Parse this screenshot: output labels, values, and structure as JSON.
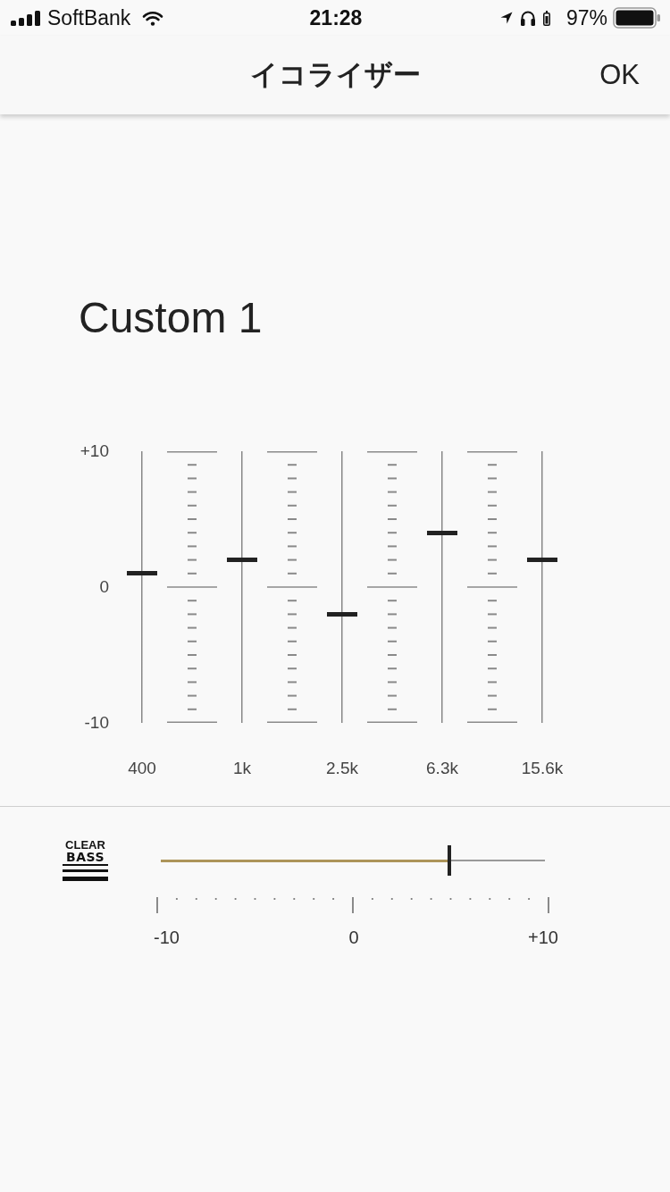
{
  "status_bar": {
    "carrier": "SoftBank",
    "time": "21:28",
    "battery": "97%"
  },
  "nav_bar": {
    "title": "イコライザー",
    "ok_button": "OK"
  },
  "preset": {
    "name": "Custom 1"
  },
  "equalizer": {
    "scale_labels": [
      "+10",
      "0",
      "-10"
    ],
    "bands": [
      {
        "label": "400",
        "level": 0.55
      },
      {
        "label": "1k",
        "level": 0.6
      },
      {
        "label": "2.5k",
        "level": 0.4
      },
      {
        "label": "6.3k",
        "level": 0.7
      },
      {
        "label": "15.6k",
        "level": 0.6
      }
    ]
  },
  "clear_bass": {
    "logo_text": [
      "CLEAR",
      "BASS"
    ],
    "level": 0.75,
    "scale_labels": [
      "-10",
      "0",
      "+10"
    ]
  }
}
